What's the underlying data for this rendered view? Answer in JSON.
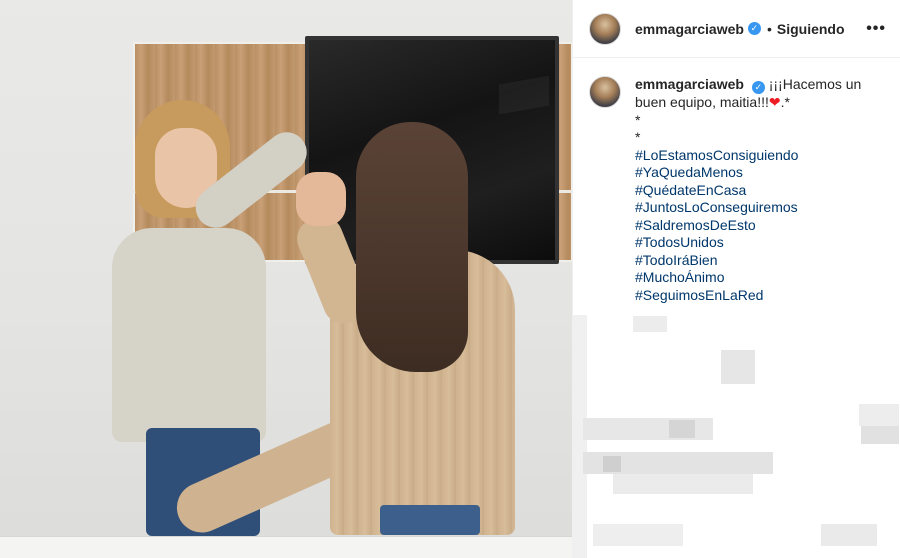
{
  "post": {
    "username": "emmagarciaweb",
    "verified_mark": "✓",
    "separator": "•",
    "follow_status": "Siguiendo",
    "more_options": "•••",
    "caption_text": "¡¡¡Hacemos un buen equipo, maitia!!!",
    "caption_heart": "❤",
    "caption_suffix": ".*",
    "caption_lines": [
      "*",
      "*"
    ],
    "hashtags": [
      "#LoEstamosConsiguiendo",
      "#YaQuedaMenos",
      "#QuédateEnCasa",
      "#JuntosLoConseguiremos",
      "#SaldremosDeEsto",
      "#TodosUnidos",
      "#TodoIráBien",
      "#MuchoÁnimo",
      "#SeguimosEnLaRed"
    ]
  },
  "icons": {
    "verified": "verified-badge-icon",
    "more": "more-options-icon"
  },
  "colors": {
    "hashtag": "#00376b",
    "verified": "#3897f0",
    "heart": "#ed1c24"
  }
}
